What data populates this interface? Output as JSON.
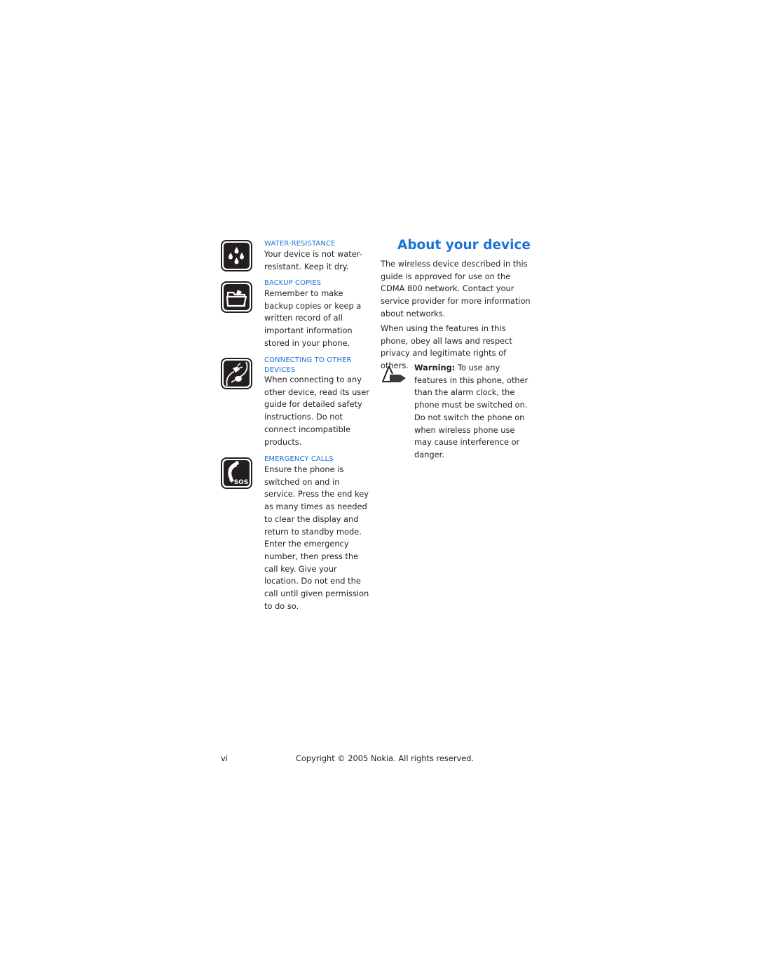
{
  "left_column": {
    "sections": [
      {
        "icon": "water-drops-icon",
        "heading": "WATER-RESISTANCE",
        "body": "Your device is not water-resistant. Keep it dry."
      },
      {
        "icon": "folder-icon",
        "heading": "BACKUP COPIES",
        "body": "Remember to make backup copies or keep a written record of all important information stored in your phone."
      },
      {
        "icon": "plug-cable-icon",
        "heading": "CONNECTING TO OTHER DEVICES",
        "body": "When connecting to any other device, read its user guide for detailed safety instructions. Do not connect incompatible products."
      },
      {
        "icon": "sos-phone-icon",
        "icon_text": "SOS",
        "heading": "EMERGENCY CALLS",
        "body": "Ensure the phone is switched on and in service. Press the end key as many times as needed to clear the display and return to standby mode. Enter the emergency number, then press the call key. Give your location. Do not end the call until given permission to do so."
      }
    ]
  },
  "right_column": {
    "title": "About your device",
    "paragraphs": [
      "The wireless device described in this guide is approved for use on the CDMA 800 network. Contact your service provider for more information about networks.",
      "When using the features in this phone, obey all laws and respect privacy and legitimate rights of others."
    ],
    "warning": {
      "icon": "warning-hand-icon",
      "label": "Warning:",
      "text": " To use any features in this phone, other than the alarm clock, the phone must be switched on. Do not switch the phone on when wireless phone use may cause interference or danger."
    }
  },
  "footer": {
    "page_number": "vi",
    "copyright": "Copyright © 2005 Nokia. All rights reserved."
  },
  "colors": {
    "accent": "#1a73d9",
    "text": "#222222",
    "icon_bg": "#231f20"
  }
}
